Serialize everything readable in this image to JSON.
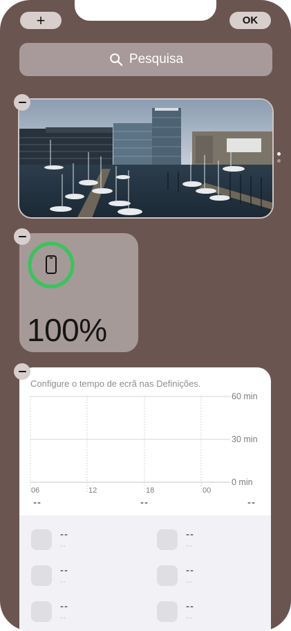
{
  "toolbar": {
    "add_label": "+",
    "done_label": "OK"
  },
  "search": {
    "label": "Pesquisa"
  },
  "battery": {
    "percent_label": "100%",
    "level": 1.0,
    "ring_color": "#34c759"
  },
  "screen_time": {
    "hint": "Configure o tempo de ecrã nas Definições.",
    "y_ticks": [
      "60 min",
      "30 min",
      "0 min"
    ],
    "x_ticks": [
      "06",
      "12",
      "18",
      "00"
    ],
    "summary": [
      "--",
      "--",
      "--"
    ],
    "apps": [
      {
        "name": "--",
        "time": "--"
      },
      {
        "name": "--",
        "time": "--"
      },
      {
        "name": "--",
        "time": "--"
      },
      {
        "name": "--",
        "time": "--"
      },
      {
        "name": "--",
        "time": "--"
      },
      {
        "name": "--",
        "time": "--"
      }
    ]
  },
  "colors": {
    "background": "#6b5550",
    "accent_green": "#34c759"
  },
  "page_dots": {
    "count": 2,
    "active": 0
  }
}
